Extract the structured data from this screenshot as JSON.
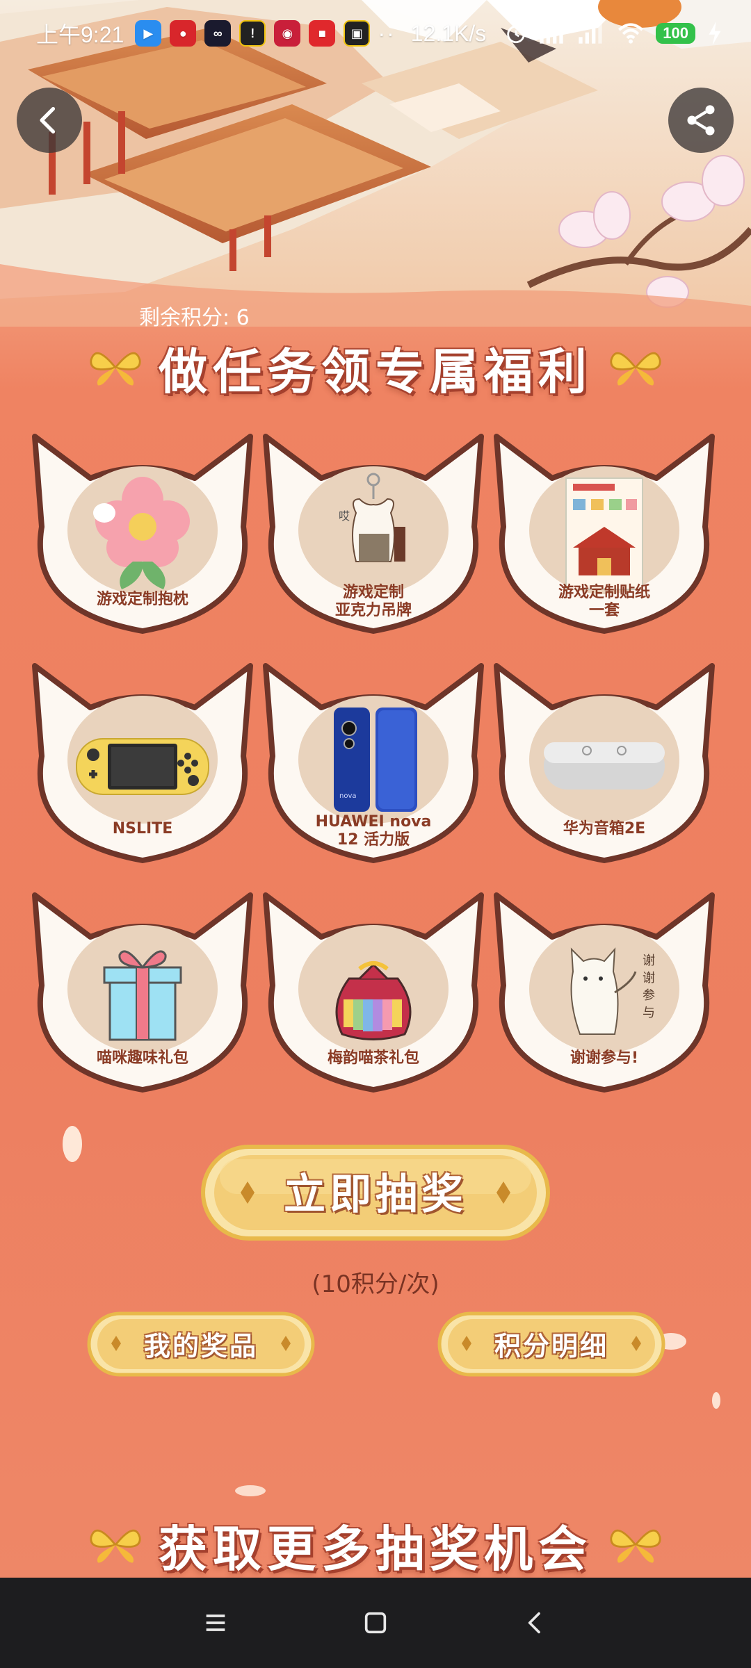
{
  "status_bar": {
    "time": "上午9:21",
    "overflow": "··",
    "net_speed": "12.1K/s",
    "battery": "100",
    "app_icons": [
      {
        "name": "app-icon-1",
        "color": "#2a8df0"
      },
      {
        "name": "app-icon-2",
        "color": "#d8262b"
      },
      {
        "name": "app-icon-3",
        "color": "#1a1a2e"
      },
      {
        "name": "app-icon-4",
        "color": "#222222"
      },
      {
        "name": "app-icon-5",
        "color": "#c91f3a"
      },
      {
        "name": "app-icon-6",
        "color": "#e0282c"
      },
      {
        "name": "app-icon-7",
        "color": "#222222"
      }
    ]
  },
  "header": {
    "back_icon": "chevron-left-icon",
    "share_icon": "share-icon"
  },
  "points": {
    "label": "剩余积分: 6"
  },
  "banner_main": {
    "title": "做任务领专属福利"
  },
  "prizes": [
    {
      "label": "游戏定制抱枕"
    },
    {
      "label": "游戏定制\n亚克力吊牌"
    },
    {
      "label": "游戏定制贴纸\n一套"
    },
    {
      "label": "NSLITE"
    },
    {
      "label": "HUAWEI nova\n12 活力版"
    },
    {
      "label": "华为音箱2E"
    },
    {
      "label": "喵咪趣味礼包"
    },
    {
      "label": "梅韵喵茶礼包"
    },
    {
      "label": "谢谢参与!"
    }
  ],
  "draw": {
    "label": "立即抽奖",
    "cost": "(10积分/次)"
  },
  "actions": {
    "my_prizes": "我的奖品",
    "points_detail": "积分明细"
  },
  "banner_more": {
    "title": "获取更多抽奖机会"
  },
  "colors": {
    "background": "#ef8160",
    "button_gold": "#f3d07c",
    "label_text": "#8a3b25",
    "card_inner": "#e9d3bd"
  }
}
